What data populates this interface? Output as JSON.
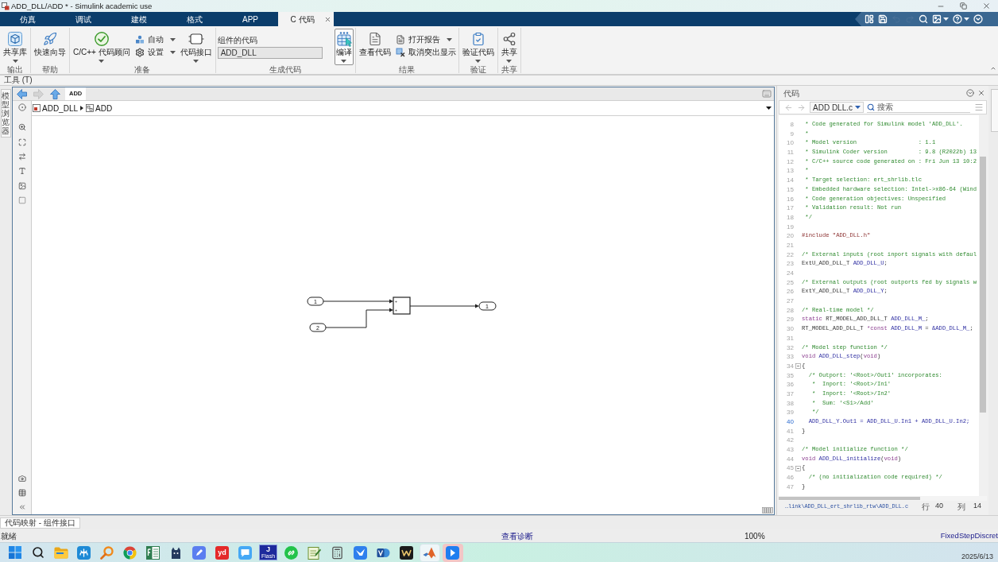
{
  "window": {
    "title": "ADD_DLL/ADD * - Simulink academic use"
  },
  "tabs": [
    {
      "label": "仿真",
      "selected": false
    },
    {
      "label": "调试",
      "selected": false
    },
    {
      "label": "建模",
      "selected": false
    },
    {
      "label": "格式",
      "selected": false
    },
    {
      "label": "APP",
      "selected": false
    },
    {
      "label": "C 代码",
      "selected": true
    }
  ],
  "quick_access": [
    {
      "kind": "layout",
      "disabled": false
    },
    {
      "kind": "save",
      "disabled": false
    },
    {
      "kind": "undo",
      "disabled": true
    },
    {
      "kind": "redo",
      "disabled": true
    },
    {
      "kind": "find",
      "disabled": false
    },
    {
      "kind": "snapshot",
      "disabled": false
    },
    {
      "kind": "help",
      "disabled": false
    },
    {
      "kind": "more",
      "disabled": false
    }
  ],
  "ribbon": {
    "sections": [
      {
        "label": "输出",
        "items": [
          {
            "kind": "large",
            "label": "共享库",
            "menu": true,
            "hovered": false
          }
        ]
      },
      {
        "label": "帮助",
        "items": [
          {
            "kind": "large",
            "label": "快速向导",
            "menu": false,
            "hovered": false
          }
        ]
      },
      {
        "label": "准备",
        "items": [
          {
            "kind": "large",
            "label": "C/C++ 代码顾问",
            "menu": true,
            "hovered": false
          },
          {
            "kind": "stack",
            "items": [
              {
                "label": "自动",
                "menu": true
              },
              {
                "label": "设置",
                "menu": true
              }
            ]
          },
          {
            "kind": "large",
            "label": "代码接口",
            "menu": true,
            "hovered": false
          }
        ]
      },
      {
        "label": "生成代码",
        "items": [
          {
            "kind": "field",
            "label": "组件的代码",
            "value": "ADD_DLL"
          },
          {
            "kind": "large",
            "label": "编译",
            "menu": true,
            "hovered": true
          }
        ]
      },
      {
        "label": "结果",
        "items": [
          {
            "kind": "large",
            "label": "查看代码",
            "menu": false,
            "hovered": false
          },
          {
            "kind": "stack",
            "items": [
              {
                "label": "打开报告",
                "menu": true
              },
              {
                "label": "取消突出显示",
                "menu": false
              }
            ]
          }
        ]
      },
      {
        "label": "验证",
        "items": [
          {
            "kind": "large",
            "label": "验证代码",
            "menu": true,
            "hovered": false
          }
        ]
      },
      {
        "label": "共享",
        "items": [
          {
            "kind": "large",
            "label": "共享",
            "menu": true,
            "hovered": false
          }
        ]
      }
    ]
  },
  "tools_label": "工具 (T)",
  "left_panel_tab": "模型浏览器",
  "editor": {
    "nav_buttons": [
      {
        "kind": "back",
        "disabled": false
      },
      {
        "kind": "forward",
        "disabled": true
      },
      {
        "kind": "up",
        "disabled": false
      }
    ],
    "tab": "ADD",
    "breadcrumb": [
      {
        "kind": "model",
        "label": "ADD_DLL"
      },
      {
        "kind": "subsystem",
        "label": "ADD"
      }
    ],
    "blocks": [
      {
        "kind": "inport",
        "label": "1"
      },
      {
        "kind": "inport",
        "label": "2"
      },
      {
        "kind": "sum",
        "signs": [
          "+",
          "+"
        ]
      },
      {
        "kind": "outport",
        "label": "1"
      }
    ]
  },
  "code_panel": {
    "title": "代码",
    "nav_buttons": [
      {
        "kind": "back",
        "disabled": true
      },
      {
        "kind": "forward",
        "disabled": true
      }
    ],
    "file": "ADD DLL.c",
    "search_placeholder": "搜索",
    "lines": [
      {
        "number": "8",
        "kind": "plain",
        "segments": [
          {
            "kind": "comment",
            "text": " * Code generated for Simulink model 'ADD_DLL'."
          }
        ]
      },
      {
        "number": "9",
        "kind": "plain",
        "segments": [
          {
            "kind": "comment",
            "text": " *"
          }
        ]
      },
      {
        "number": "10",
        "kind": "plain",
        "segments": [
          {
            "kind": "comment",
            "text": " * Model version                  : 1.1"
          }
        ]
      },
      {
        "number": "11",
        "kind": "plain",
        "segments": [
          {
            "kind": "comment",
            "text": " * Simulink Coder version         : 9.8 (R2022b) 13"
          }
        ]
      },
      {
        "number": "12",
        "kind": "plain",
        "segments": [
          {
            "kind": "comment",
            "text": " * C/C++ source code generated on : Fri Jun 13 10:2"
          }
        ]
      },
      {
        "number": "13",
        "kind": "plain",
        "segments": [
          {
            "kind": "comment",
            "text": " *"
          }
        ]
      },
      {
        "number": "14",
        "kind": "plain",
        "segments": [
          {
            "kind": "comment",
            "text": " * Target selection: ert_shrlib.tlc"
          }
        ]
      },
      {
        "number": "15",
        "kind": "plain",
        "segments": [
          {
            "kind": "comment",
            "text": " * Embedded hardware selection: Intel->x86-64 (Wind"
          }
        ]
      },
      {
        "number": "16",
        "kind": "plain",
        "segments": [
          {
            "kind": "comment",
            "text": " * Code generation objectives: Unspecified"
          }
        ]
      },
      {
        "number": "17",
        "kind": "plain",
        "segments": [
          {
            "kind": "comment",
            "text": " * Validation result: Not run"
          }
        ]
      },
      {
        "number": "18",
        "kind": "plain",
        "segments": [
          {
            "kind": "comment",
            "text": " */"
          }
        ]
      },
      {
        "number": "19",
        "kind": "plain"
      },
      {
        "number": "20",
        "kind": "plain",
        "segments": [
          {
            "kind": "preproc",
            "text": "#include \"ADD_DLL.h\""
          }
        ]
      },
      {
        "number": "21",
        "kind": "plain"
      },
      {
        "number": "22",
        "kind": "plain",
        "segments": [
          {
            "kind": "comment",
            "text": "/* External inputs (root inport signals with defaul"
          }
        ]
      },
      {
        "number": "23",
        "kind": "plain",
        "segments": [
          {
            "kind": "plain",
            "text": "ExtU_ADD_DLL_T "
          },
          {
            "kind": "ident",
            "text": "ADD_DLL_U"
          },
          {
            "kind": "plain",
            "text": ";"
          }
        ]
      },
      {
        "number": "24",
        "kind": "plain"
      },
      {
        "number": "25",
        "kind": "plain",
        "segments": [
          {
            "kind": "comment",
            "text": "/* External outputs (root outports fed by signals w"
          }
        ]
      },
      {
        "number": "26",
        "kind": "plain",
        "segments": [
          {
            "kind": "plain",
            "text": "ExtY_ADD_DLL_T "
          },
          {
            "kind": "ident",
            "text": "ADD_DLL_Y"
          },
          {
            "kind": "plain",
            "text": ";"
          }
        ]
      },
      {
        "number": "27",
        "kind": "plain"
      },
      {
        "number": "28",
        "kind": "plain",
        "segments": [
          {
            "kind": "comment",
            "text": "/* Real-time model */"
          }
        ]
      },
      {
        "number": "29",
        "kind": "plain",
        "segments": [
          {
            "kind": "keyword",
            "text": "static"
          },
          {
            "kind": "plain",
            "text": " RT_MODEL_ADD_DLL_T "
          },
          {
            "kind": "ident",
            "text": "ADD_DLL_M_"
          },
          {
            "kind": "plain",
            "text": ";"
          }
        ]
      },
      {
        "number": "30",
        "kind": "plain",
        "segments": [
          {
            "kind": "plain",
            "text": "RT_MODEL_ADD_DLL_T "
          },
          {
            "kind": "keyword",
            "text": "*const"
          },
          {
            "kind": "ident",
            "text": " ADD_DLL_M"
          },
          {
            "kind": "plain",
            "text": " = "
          },
          {
            "kind": "ident",
            "text": "&ADD_DLL_M_"
          },
          {
            "kind": "plain",
            "text": ";"
          }
        ]
      },
      {
        "number": "31",
        "kind": "plain"
      },
      {
        "number": "32",
        "kind": "plain",
        "segments": [
          {
            "kind": "comment",
            "text": "/* Model step function */"
          }
        ]
      },
      {
        "number": "33",
        "kind": "plain",
        "segments": [
          {
            "kind": "keyword",
            "text": "void"
          },
          {
            "kind": "ident",
            "text": " ADD_DLL_step"
          },
          {
            "kind": "plain",
            "text": "("
          },
          {
            "kind": "keyword",
            "text": "void"
          },
          {
            "kind": "plain",
            "text": ")"
          }
        ]
      },
      {
        "number": "34",
        "kind": "fold",
        "segments": [
          {
            "kind": "plain",
            "text": "{"
          }
        ]
      },
      {
        "number": "35",
        "kind": "plain",
        "segments": [
          {
            "kind": "comment",
            "text": "  /* Outport: '<Root>/Out1' incorporates:"
          }
        ]
      },
      {
        "number": "36",
        "kind": "plain",
        "segments": [
          {
            "kind": "comment",
            "text": "   *  Inport: '<Root>/In1'"
          }
        ]
      },
      {
        "number": "37",
        "kind": "plain",
        "segments": [
          {
            "kind": "comment",
            "text": "   *  Inport: '<Root>/In2'"
          }
        ]
      },
      {
        "number": "38",
        "kind": "plain",
        "segments": [
          {
            "kind": "comment",
            "text": "   *  Sum: '<S1>/Add'"
          }
        ]
      },
      {
        "number": "39",
        "kind": "plain",
        "segments": [
          {
            "kind": "comment",
            "text": "   */"
          }
        ]
      },
      {
        "number": "40",
        "kind": "current",
        "segments": [
          {
            "kind": "ident",
            "text": "  ADD_DLL_Y.Out1 = ADD_DLL_U.In1 + ADD_DLL_U.In2;"
          }
        ]
      },
      {
        "number": "41",
        "kind": "plain",
        "segments": [
          {
            "kind": "plain",
            "text": "}"
          }
        ]
      },
      {
        "number": "42",
        "kind": "plain"
      },
      {
        "number": "43",
        "kind": "plain",
        "segments": [
          {
            "kind": "comment",
            "text": "/* Model initialize function */"
          }
        ]
      },
      {
        "number": "44",
        "kind": "plain",
        "segments": [
          {
            "kind": "keyword",
            "text": "void"
          },
          {
            "kind": "ident",
            "text": " ADD_DLL_initialize"
          },
          {
            "kind": "plain",
            "text": "("
          },
          {
            "kind": "keyword",
            "text": "void"
          },
          {
            "kind": "plain",
            "text": ")"
          }
        ]
      },
      {
        "number": "45",
        "kind": "fold",
        "segments": [
          {
            "kind": "plain",
            "text": "{"
          }
        ]
      },
      {
        "number": "46",
        "kind": "plain",
        "segments": [
          {
            "kind": "comment",
            "text": "  /* (no initialization code required) */"
          }
        ]
      },
      {
        "number": "47",
        "kind": "plain",
        "segments": [
          {
            "kind": "plain",
            "text": "}"
          }
        ]
      }
    ],
    "status": {
      "path": "…link\\ADD_DLL_ert_shrlib_rtw\\ADD_DLL.c",
      "line_label": "行",
      "line": "40",
      "col_label": "列",
      "col": "14"
    }
  },
  "bottom_tab": "代码映射 - 组件接口",
  "status_bar": {
    "state": "就绪",
    "diagnostics": "查看诊断",
    "zoom": "100%",
    "solver": "FixedStepDiscret"
  },
  "taskbar": {
    "items": [
      {
        "kind": "start",
        "selected": false,
        "open": false
      },
      {
        "kind": "search",
        "selected": false,
        "open": false
      },
      {
        "kind": "folder",
        "selected": false,
        "open": false
      },
      {
        "kind": "swirl",
        "selected": false,
        "open": false
      },
      {
        "kind": "magnifier",
        "selected": false,
        "open": false
      },
      {
        "kind": "browser",
        "selected": false,
        "open": false
      },
      {
        "kind": "sheet",
        "selected": false,
        "open": false
      },
      {
        "kind": "cat",
        "selected": false,
        "open": false
      },
      {
        "kind": "pen",
        "selected": false,
        "open": false
      },
      {
        "kind": "tile",
        "label": "yd",
        "selected": false,
        "open": false
      },
      {
        "kind": "chat",
        "selected": false,
        "open": false
      },
      {
        "kind": "flash",
        "label": "J",
        "caption": "Flash",
        "selected": false,
        "open": false
      },
      {
        "kind": "link",
        "selected": false,
        "open": false
      },
      {
        "kind": "notepad",
        "selected": false,
        "open": false
      },
      {
        "kind": "calculator",
        "selected": false,
        "open": false
      },
      {
        "kind": "bird",
        "selected": false,
        "open": false
      },
      {
        "kind": "studio",
        "selected": false,
        "open": false
      },
      {
        "kind": "wps",
        "selected": false,
        "open": false
      },
      {
        "kind": "matlab",
        "selected": false,
        "open": true
      },
      {
        "kind": "arrow",
        "selected": true,
        "open": false
      }
    ],
    "date": "2025/6/13"
  }
}
